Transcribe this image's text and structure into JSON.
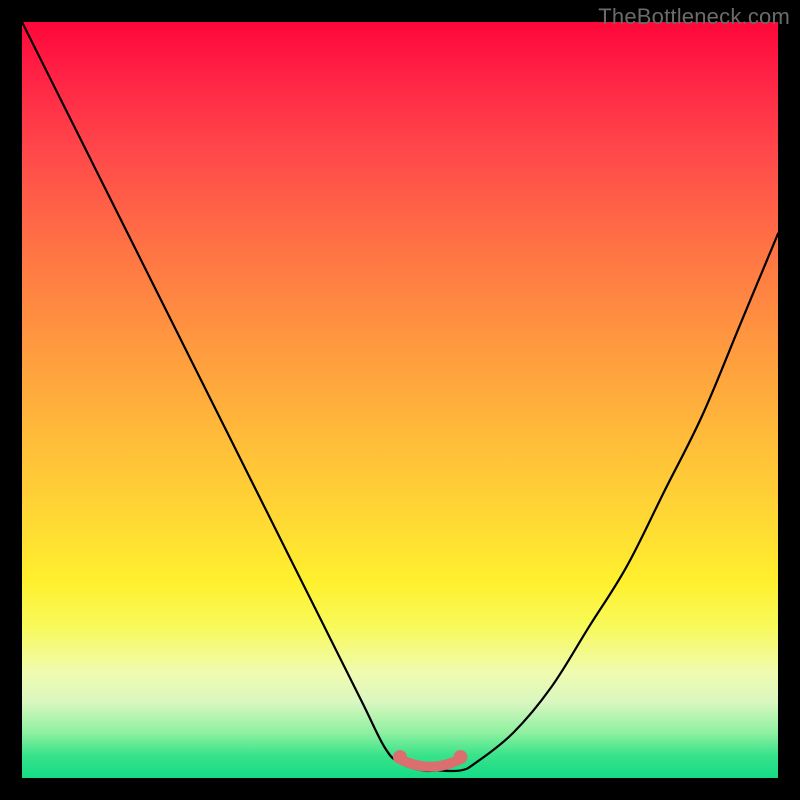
{
  "watermark": "TheBottleneck.com",
  "colors": {
    "frame": "#000000",
    "curve": "#000000",
    "marker": "#db6e6e"
  },
  "chart_data": {
    "type": "line",
    "title": "",
    "xlabel": "",
    "ylabel": "",
    "xlim": [
      0,
      100
    ],
    "ylim": [
      0,
      100
    ],
    "grid": false,
    "legend": false,
    "series": [
      {
        "name": "bottleneck-curve",
        "x": [
          0,
          5,
          10,
          15,
          20,
          25,
          30,
          35,
          40,
          45,
          48,
          50,
          53,
          55,
          58,
          60,
          65,
          70,
          75,
          80,
          85,
          90,
          95,
          100
        ],
        "y": [
          100,
          90,
          80,
          70,
          60,
          50,
          40,
          30,
          20,
          10,
          4,
          2,
          1,
          1,
          1,
          2,
          6,
          12,
          20,
          28,
          38,
          48,
          60,
          72
        ]
      }
    ],
    "highlight_range": {
      "x_start": 50,
      "x_end": 58,
      "y": 1
    },
    "background_gradient": [
      {
        "pos": 0,
        "color": "#ff073a"
      },
      {
        "pos": 50,
        "color": "#ffb93a"
      },
      {
        "pos": 80,
        "color": "#f8fa5a"
      },
      {
        "pos": 100,
        "color": "#14db86"
      }
    ]
  }
}
